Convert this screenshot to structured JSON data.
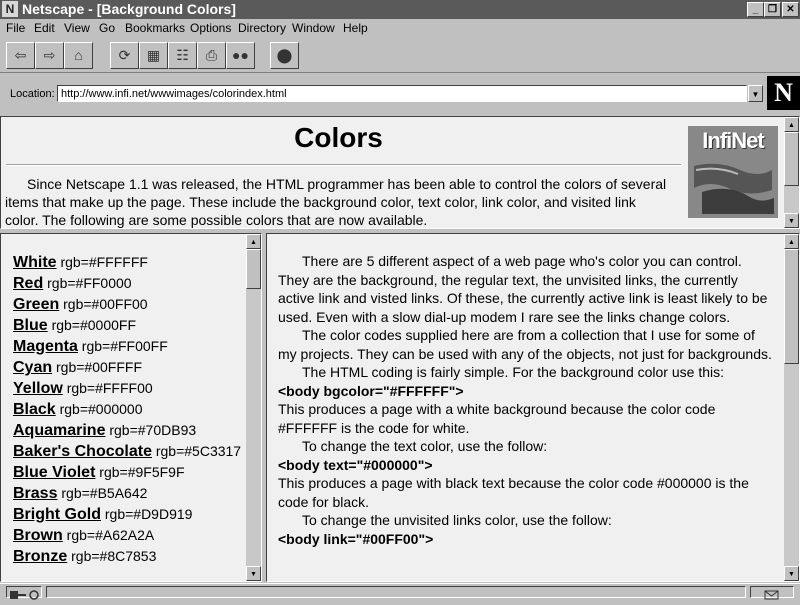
{
  "window": {
    "title": "Netscape - [Background Colors]"
  },
  "menu": [
    "File",
    "Edit",
    "View",
    "Go",
    "Bookmarks",
    "Options",
    "Directory",
    "Window",
    "Help"
  ],
  "location": {
    "label": "Location:",
    "url": "http://www.infi.net/wwwimages/colorindex.html"
  },
  "header": {
    "heading": "Colors",
    "logo_text": "InfiNet",
    "intro": "Since Netscape 1.1 was released, the HTML programmer has been able to control the colors of several items that make up the page. These include the background color, text color, link color, and visited link color. The following are some possible colors that are now available."
  },
  "colors": [
    {
      "name": "White",
      "value": "rgb=#FFFFFF"
    },
    {
      "name": "Red",
      "value": "rgb=#FF0000"
    },
    {
      "name": "Green",
      "value": "rgb=#00FF00"
    },
    {
      "name": "Blue",
      "value": "rgb=#0000FF"
    },
    {
      "name": "Magenta",
      "value": "rgb=#FF00FF"
    },
    {
      "name": "Cyan",
      "value": "rgb=#00FFFF"
    },
    {
      "name": "Yellow",
      "value": "rgb=#FFFF00"
    },
    {
      "name": "Black",
      "value": "rgb=#000000"
    },
    {
      "name": "Aquamarine",
      "value": "rgb=#70DB93"
    },
    {
      "name": "Baker's Chocolate",
      "value": "rgb=#5C3317"
    },
    {
      "name": "Blue Violet",
      "value": "rgb=#9F5F9F"
    },
    {
      "name": "Brass",
      "value": "rgb=#B5A642"
    },
    {
      "name": "Bright Gold",
      "value": "rgb=#D9D919"
    },
    {
      "name": "Brown",
      "value": "rgb=#A62A2A"
    },
    {
      "name": "Bronze",
      "value": "rgb=#8C7853"
    }
  ],
  "article": {
    "p1": "There are 5 different aspect of a web page who's color you can control. They are the background, the regular text, the unvisited links, the currently active link and visted links. Of these, the currently active link is least likely to be used. Even with a slow dial-up modem I rare see the links change colors.",
    "p2": "The color codes supplied here are from a collection that I use for some of my projects. They can be used with any of the objects, not just for backgrounds.",
    "p3": "The HTML coding is fairly simple. For the background color use this:",
    "code1": "<body bgcolor=\"#FFFFFF\">",
    "p4": "This produces a page with a white background because the color code #FFFFFF is the code for white.",
    "p5": "To change the text color, use the follow:",
    "code2": "<body text=\"#000000\">",
    "p6": "This produces a page with black text because the color code #000000 is the code for black.",
    "p7": "To change the unvisited links color, use the follow:",
    "code3": "<body link=\"#00FF00\">"
  }
}
